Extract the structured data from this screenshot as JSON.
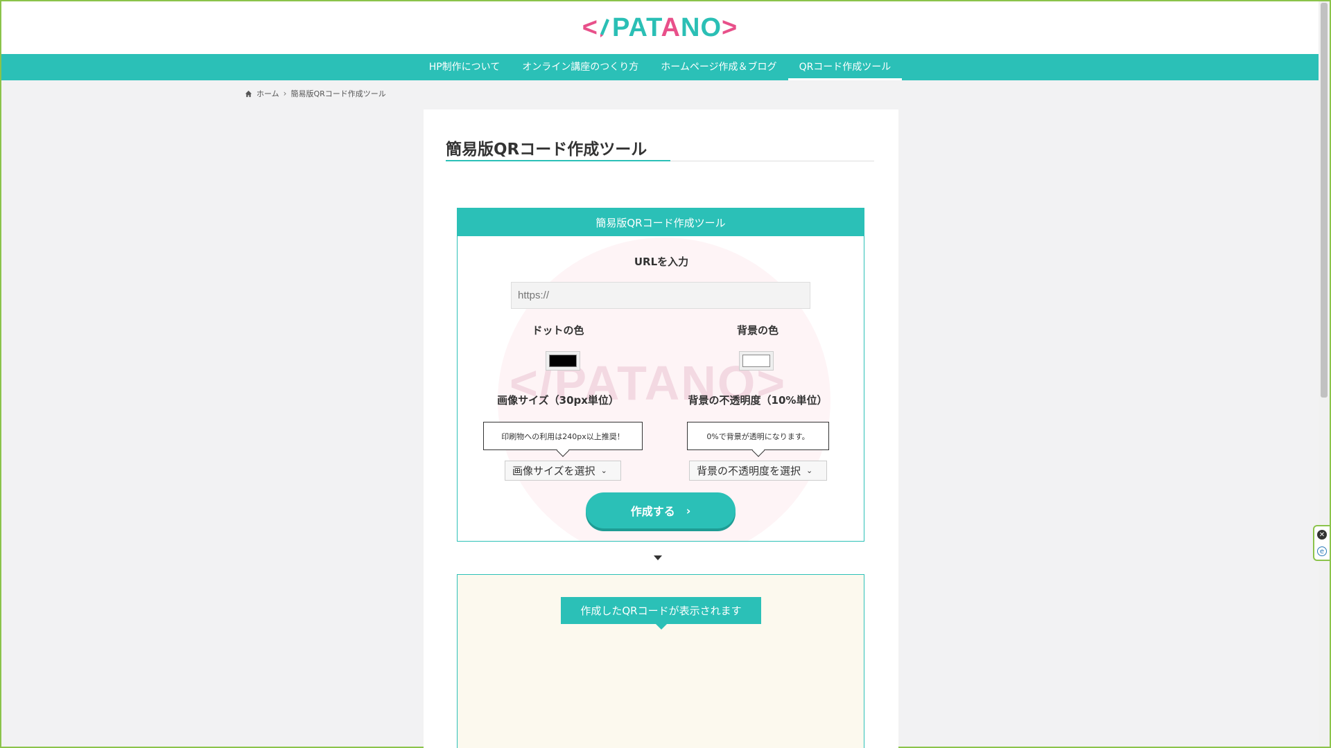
{
  "header": {
    "logo": {
      "lt": "<",
      "slash": "/",
      "word_a": "PAT",
      "word_o": "A",
      "word_b": "NO",
      "gt": ">"
    }
  },
  "nav": {
    "items": [
      {
        "label": "HP制作について",
        "active": false
      },
      {
        "label": "オンライン講座のつくり方",
        "active": false
      },
      {
        "label": "ホームページ作成＆ブログ",
        "active": false
      },
      {
        "label": "QRコード作成ツール",
        "active": true
      }
    ]
  },
  "breadcrumb": {
    "home": "ホーム",
    "sep": "›",
    "current": "簡易版QRコード作成ツール"
  },
  "page": {
    "title": "簡易版QRコード作成ツール"
  },
  "tool": {
    "header": "簡易版QRコード作成ツール",
    "watermark": "</PATANO>",
    "url_label": "URLを入力",
    "url_placeholder": "https://",
    "dot_color_label": "ドットの色",
    "bg_color_label": "背景の色",
    "dot_color": "#000000",
    "bg_color": "#ffffff",
    "size_label": "画像サイズ（30px単位）",
    "opacity_label": "背景の不透明度（10%単位）",
    "size_tip": "印刷物への利用は240px以上推奨！",
    "opacity_tip": "0%で背景が透明になります。",
    "size_select": "画像サイズを選択",
    "opacity_select": "背景の不透明度を選択",
    "create_button": "作成する",
    "create_chevron": "›"
  },
  "result": {
    "label": "作成したQRコードが表示されます"
  },
  "colors": {
    "accent": "#2bc0b7",
    "pink": "#e8508a",
    "result_bg": "#fcf9ee"
  },
  "side_widget": {
    "icons": [
      "close-circle-icon",
      "edge-icon"
    ]
  }
}
